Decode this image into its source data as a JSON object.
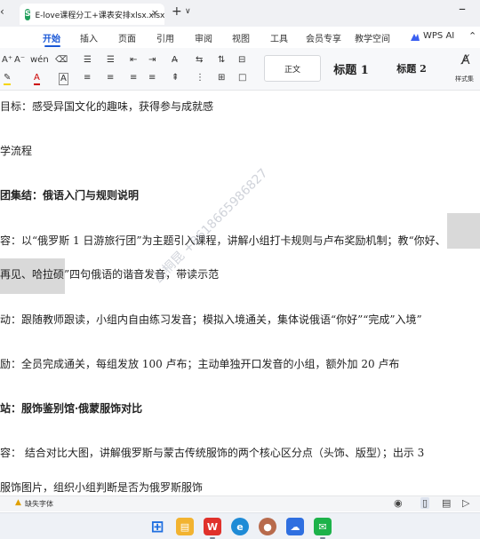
{
  "window": {
    "tab_title": "E-love课程分工+课表安排xlsx.xlsx",
    "tab_icon": "spreadsheet-s-icon",
    "new_tab_symbol": "+",
    "tab_menu_symbol": "∨",
    "close_symbol": "×"
  },
  "ribbon": {
    "tabs": [
      "开始",
      "插入",
      "页面",
      "引用",
      "审阅",
      "视图",
      "工具",
      "会员专享",
      "教学空间",
      "WPS AI"
    ],
    "active_tab": "开始",
    "accent_color": "#1a58d6"
  },
  "toolbar": {
    "styles": {
      "normal": "正文",
      "h1": "标题 1",
      "h2": "标题 2"
    },
    "styles_panel_label": "样式集",
    "row1_glyphs": [
      "A⁺",
      "A⁻",
      "wén",
      "⌫",
      "☰",
      "☰",
      "⇤",
      "⇥",
      "⇅",
      "⚌",
      "≡"
    ],
    "row2_glyphs": [
      "A",
      "A",
      "A",
      "≡",
      "≡",
      "≡",
      "≡",
      "⇞",
      "⋮",
      "⊞",
      "□"
    ]
  },
  "document": {
    "lines": [
      "目标：感受异国文化的趣味，获得参与成就感",
      "学流程",
      "团集结：俄语入门与规则说明",
      "容：以“俄罗斯 1 日游旅行团”为主题引入课程，讲解小组打卡规则与卢布奖励机制；教“你好、",
      "再见、哈拉硕”四句俄语的谐音发音，带读示范",
      "动：跟随教师跟读，小组内自由练习发音；模拟入境通关，集体说俄语“你好”“完成”入境”",
      "励：全员完成通关，每组发放 100 卢布；主动单独开口发音的小组，额外加 20 卢布",
      "站：服饰鉴别馆·俄蒙服饰对比",
      "容：  结合对比大图，讲解俄罗斯与蒙古传统服饰的两个核心区分点（头饰、版型）；出示 3",
      "服饰图片，组织小组判断是否为俄罗斯服饰"
    ],
    "bold_lines": [
      2,
      7
    ],
    "watermark": "丛桐昆 +8618665986827"
  },
  "statusbar": {
    "warning_text": "缺失字体",
    "icons": [
      "eye-icon",
      "page-view-icon",
      "read-view-icon",
      "outline-view-icon",
      "play-icon"
    ]
  },
  "taskbar": {
    "apps": [
      {
        "name": "windows-start",
        "glyph": "⊞",
        "color": "#1f6fe0"
      },
      {
        "name": "file-explorer",
        "glyph": "▤",
        "color": "#f2b330"
      },
      {
        "name": "wps-office",
        "glyph": "W",
        "color": "#e0312b"
      },
      {
        "name": "edge-browser",
        "glyph": "e",
        "color": "#1f8bd6"
      },
      {
        "name": "contacts-avatar",
        "glyph": "●",
        "color": "#b86b4d"
      },
      {
        "name": "wps-cloud",
        "glyph": "☁",
        "color": "#2f6fe0"
      },
      {
        "name": "wechat",
        "glyph": "✉",
        "color": "#1db24a"
      }
    ]
  }
}
